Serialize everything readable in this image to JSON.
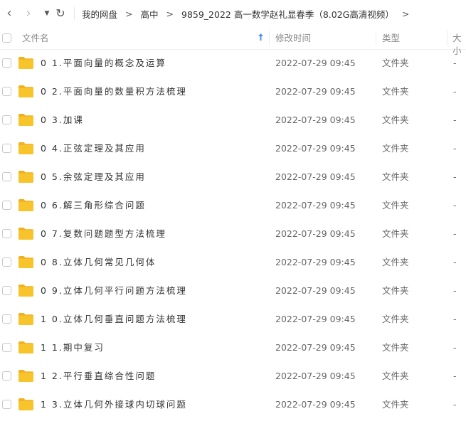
{
  "nav": {
    "back_glyph": "‹",
    "forward_glyph": "›",
    "dropdown_glyph": "▼",
    "refresh_glyph": "↻"
  },
  "breadcrumb": {
    "separator": ">",
    "items": [
      "我的网盘",
      "高中",
      "9859_2022 高一数学赵礼显春季（8.02G高清视频）"
    ]
  },
  "header": {
    "name": "文件名",
    "modified": "修改时间",
    "type": "类型",
    "size": "大小"
  },
  "colors": {
    "folder": "#f8c42c",
    "folder_tab": "#f2b01e",
    "accent": "#4b8df8"
  },
  "files": [
    {
      "name": "0 1.平面向量的概念及运算",
      "date": "2022-07-29 09:45",
      "type": "文件夹",
      "size": "-"
    },
    {
      "name": "0 2.平面向量的数量积方法梳理",
      "date": "2022-07-29 09:45",
      "type": "文件夹",
      "size": "-"
    },
    {
      "name": "0 3.加课",
      "date": "2022-07-29 09:45",
      "type": "文件夹",
      "size": "-"
    },
    {
      "name": "0 4.正弦定理及其应用",
      "date": "2022-07-29 09:45",
      "type": "文件夹",
      "size": "-"
    },
    {
      "name": "0 5.余弦定理及其应用",
      "date": "2022-07-29 09:45",
      "type": "文件夹",
      "size": "-"
    },
    {
      "name": "0 6.解三角形综合问题",
      "date": "2022-07-29 09:45",
      "type": "文件夹",
      "size": "-"
    },
    {
      "name": "0 7.复数问题题型方法梳理",
      "date": "2022-07-29 09:45",
      "type": "文件夹",
      "size": "-"
    },
    {
      "name": "0 8.立体几何常见几何体",
      "date": "2022-07-29 09:45",
      "type": "文件夹",
      "size": "-"
    },
    {
      "name": "0 9.立体几何平行问题方法梳理",
      "date": "2022-07-29 09:45",
      "type": "文件夹",
      "size": "-"
    },
    {
      "name": "1 0.立体几何垂直问题方法梳理",
      "date": "2022-07-29 09:45",
      "type": "文件夹",
      "size": "-"
    },
    {
      "name": "1 1.期中复习",
      "date": "2022-07-29 09:45",
      "type": "文件夹",
      "size": "-"
    },
    {
      "name": "1 2.平行垂直综合性问题",
      "date": "2022-07-29 09:45",
      "type": "文件夹",
      "size": "-"
    },
    {
      "name": "1 3.立体几何外接球内切球问题",
      "date": "2022-07-29 09:45",
      "type": "文件夹",
      "size": "-"
    }
  ]
}
